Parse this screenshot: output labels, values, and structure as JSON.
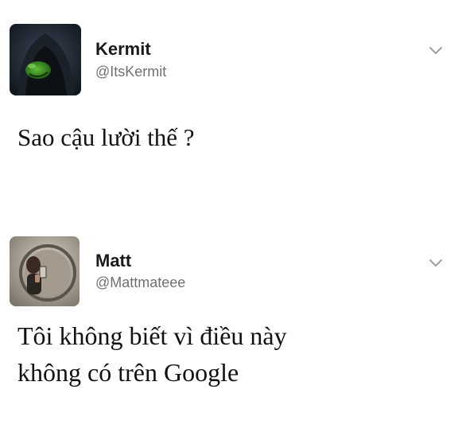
{
  "tweets": [
    {
      "display_name": "Kermit",
      "handle": "@ItsKermit",
      "text": "Sao cậu lười thế ?",
      "avatar_icon": "hooded-kermit-avatar",
      "menu_icon": "chevron-down-icon"
    },
    {
      "display_name": "Matt",
      "handle": "@Mattmateee",
      "text_lines": [
        "Tôi không biết vì điều này",
        "không có trên Google"
      ],
      "avatar_icon": "mirror-selfie-avatar",
      "menu_icon": "chevron-down-icon"
    }
  ],
  "colors": {
    "background": "#ffffff",
    "name": "#1a1a1a",
    "handle": "#707070",
    "chevron": "#9aa0a6"
  }
}
